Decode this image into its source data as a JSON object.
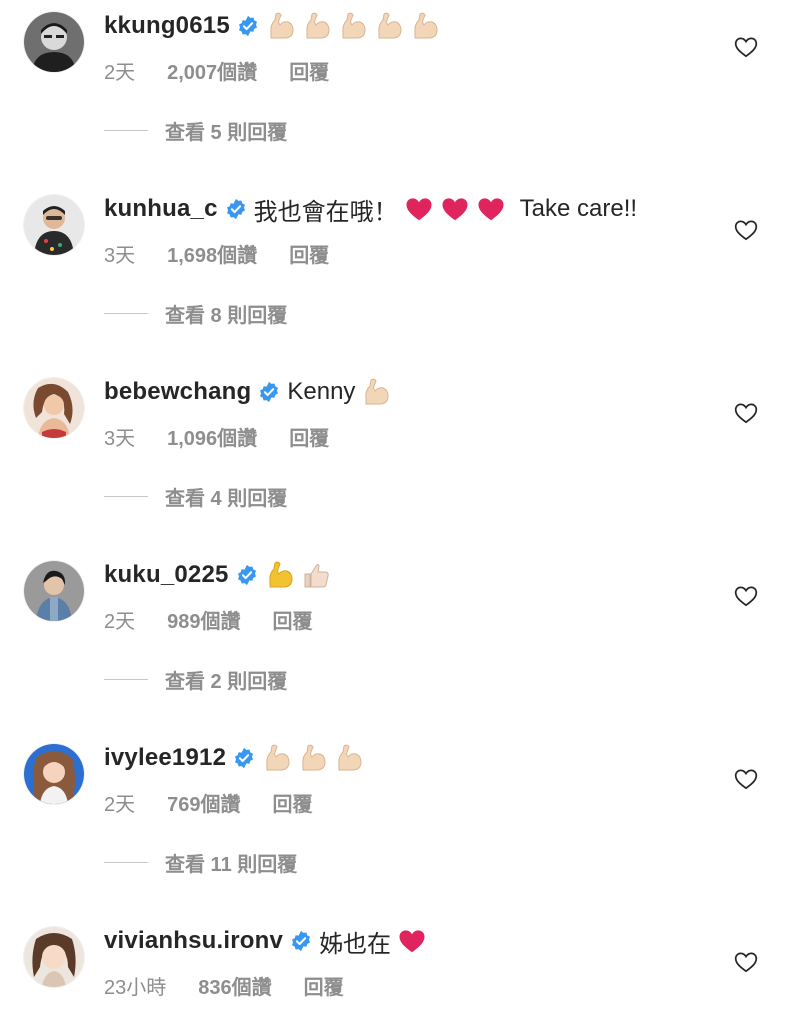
{
  "comments": [
    {
      "username": "kkung0615",
      "text": "",
      "emoji_before": [],
      "emoji_after": [
        "flexed-biceps-light",
        "flexed-biceps-light",
        "flexed-biceps-light",
        "flexed-biceps-light",
        "flexed-biceps-light"
      ],
      "time": "2天",
      "likes": "2,007個讚",
      "reply_label": "回覆",
      "view_replies": "查看 5 則回覆"
    },
    {
      "username": "kunhua_c",
      "text": "我也會在哦！",
      "emoji_after": [
        "red-heart",
        "red-heart",
        "red-heart"
      ],
      "text_after": "Take care!!",
      "time": "3天",
      "likes": "1,698個讚",
      "reply_label": "回覆",
      "view_replies": "查看 8 則回覆"
    },
    {
      "username": "bebewchang",
      "text": "Kenny",
      "emoji_after": [
        "flexed-biceps-light"
      ],
      "time": "3天",
      "likes": "1,096個讚",
      "reply_label": "回覆",
      "view_replies": "查看 4 則回覆"
    },
    {
      "username": "kuku_0225",
      "text": "",
      "emoji_after": [
        "flexed-biceps-yellow",
        "thumbs-up-light"
      ],
      "time": "2天",
      "likes": "989個讚",
      "reply_label": "回覆",
      "view_replies": "查看 2 則回覆"
    },
    {
      "username": "ivylee1912",
      "text": "",
      "emoji_after": [
        "flexed-biceps-light",
        "flexed-biceps-light",
        "flexed-biceps-light"
      ],
      "time": "2天",
      "likes": "769個讚",
      "reply_label": "回覆",
      "view_replies": "查看 11 則回覆"
    },
    {
      "username": "vivianhsu.ironv",
      "text": "姊也在",
      "emoji_after": [
        "red-heart"
      ],
      "time": "23小時",
      "likes": "836個讚",
      "reply_label": "回覆",
      "view_replies": ""
    }
  ],
  "icons": {
    "verified": "verified-badge-icon",
    "like": "heart-outline-icon"
  },
  "colors": {
    "username": "#262626",
    "meta": "#8e8e8e",
    "verified": "#3897f0",
    "heart_emoji": "#e0245e"
  }
}
